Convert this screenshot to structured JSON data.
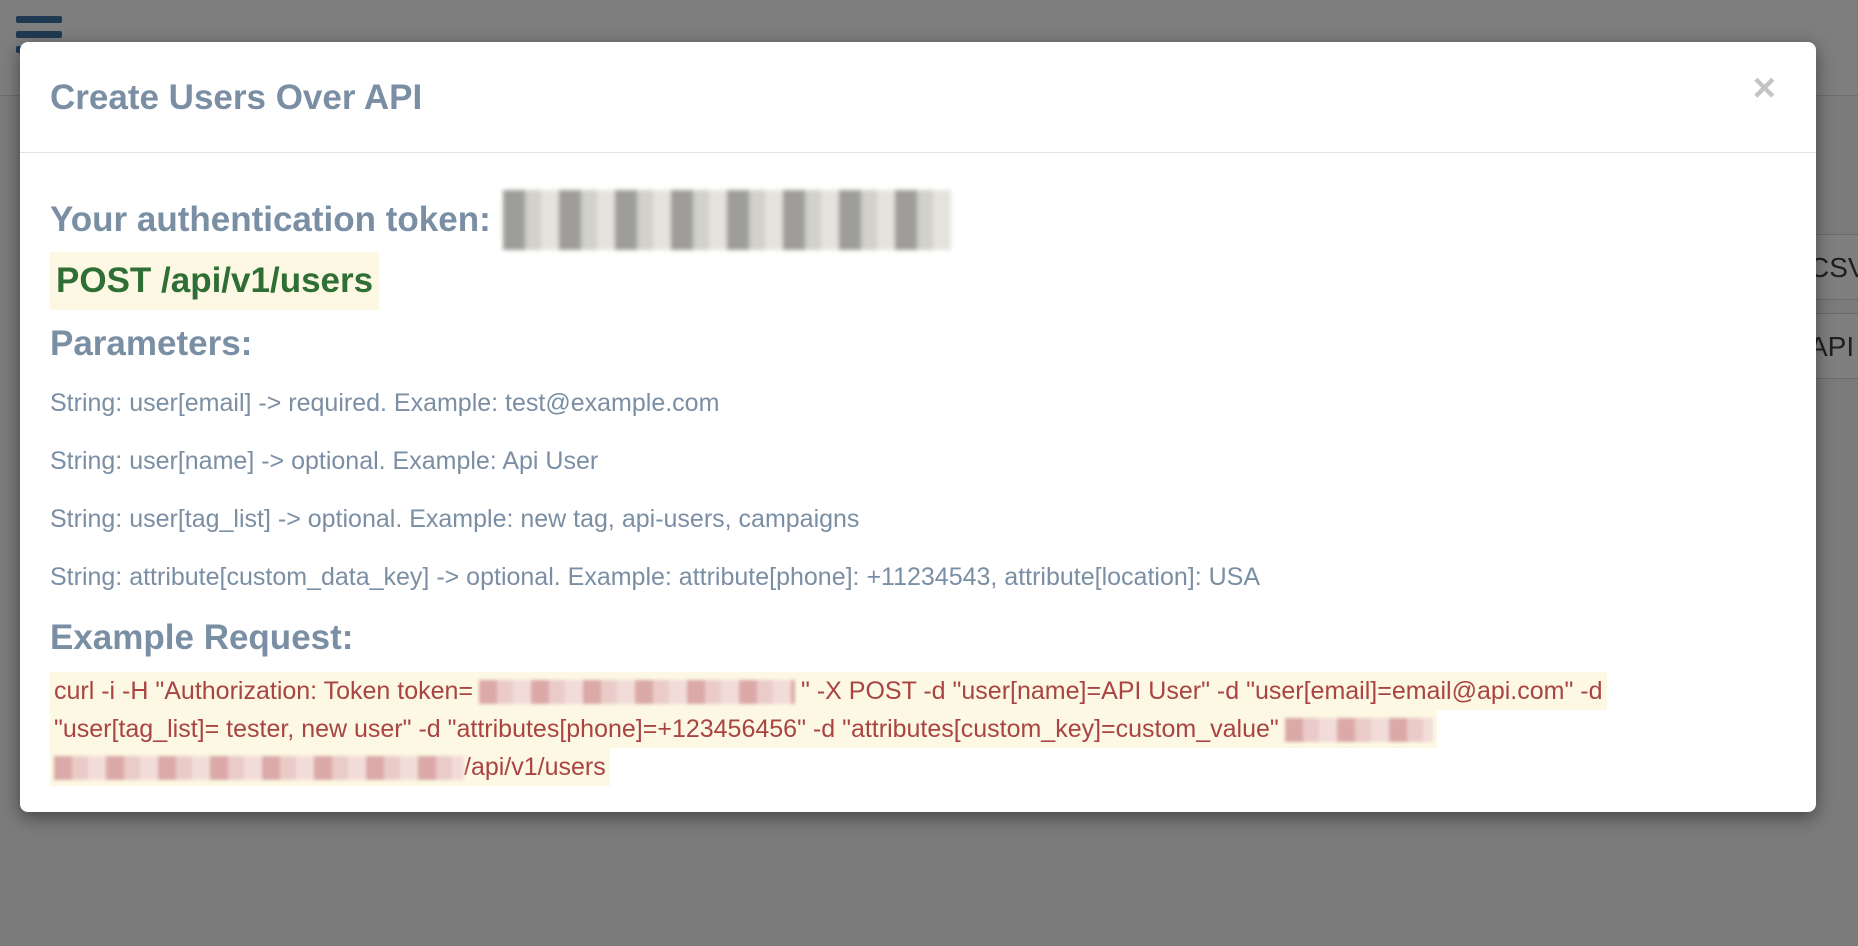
{
  "modal": {
    "title": "Create Users Over API",
    "close_label": "×",
    "token_label": "Your authentication token:",
    "endpoint": "POST /api/v1/users",
    "parameters_title": "Parameters:",
    "parameters": [
      "String: user[email] -> required. Example: test@example.com",
      "String: user[name] -> optional. Example: Api User",
      "String: user[tag_list] -> optional. Example: new tag, api-users, campaigns",
      "String: attribute[custom_data_key] -> optional. Example: attribute[phone]: +11234543, attribute[location]: USA"
    ],
    "example_title": "Example Request:",
    "example": {
      "line1_a": "curl -i -H \"Authorization: Token token=",
      "line1_b": "\" -X POST -d \"user[name]=API User\" -d \"user[email]=email@api.com\" -d",
      "line2": "\"user[tag_list]= tester, new user\" -d \"attributes[phone]=+123456456\" -d \"attributes[custom_key]=custom_value\"",
      "line3": "/api/v1/users"
    }
  },
  "background": {
    "csv_button_label": "CSV",
    "api_button_label": "API"
  },
  "colors": {
    "heading": "#7a8ea4",
    "endpoint_text": "#2f6e34",
    "code_text": "#a94442",
    "highlight_bg": "#fcf8e3",
    "overlay": "#7b7b7b"
  }
}
